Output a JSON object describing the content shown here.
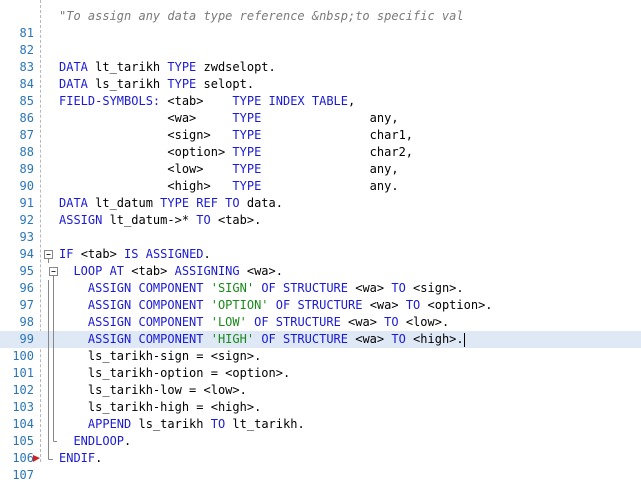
{
  "editor": {
    "highlight_color": "#dfe8f5",
    "keyword_color": "#1b1bd6",
    "string_color": "#1a8a1a",
    "comment_color": "#7a7a7a",
    "line_number_color": "#2b76b9",
    "lines": [
      {
        "n": "",
        "tokens": [
          [
            "cm",
            "\"To assign any data type reference &nbsp;to specific val"
          ]
        ]
      },
      {
        "n": "81",
        "tokens": []
      },
      {
        "n": "82",
        "tokens": []
      },
      {
        "n": "83",
        "tokens": [
          [
            "kw",
            "DATA"
          ],
          [
            "",
            "lt_tarikh "
          ],
          [
            "kw",
            "TYPE"
          ],
          [
            "",
            "zwdselopt."
          ]
        ]
      },
      {
        "n": "84",
        "tokens": [
          [
            "kw",
            "DATA"
          ],
          [
            "",
            "ls_tarikh "
          ],
          [
            "kw",
            "TYPE"
          ],
          [
            "",
            "selopt."
          ]
        ]
      },
      {
        "n": "85",
        "tokens": [
          [
            "kw",
            "FIELD-SYMBOLS:"
          ],
          [
            "",
            "<tab>    "
          ],
          [
            "kw",
            "TYPE INDEX TABLE"
          ],
          [
            "",
            ","
          ]
        ]
      },
      {
        "n": "86",
        "tokens": [
          [
            "",
            "               <wa>     "
          ],
          [
            "kw",
            "TYPE"
          ],
          [
            "",
            "               any,"
          ]
        ]
      },
      {
        "n": "87",
        "tokens": [
          [
            "",
            "               <sign>   "
          ],
          [
            "kw",
            "TYPE"
          ],
          [
            "",
            "               char1,"
          ]
        ]
      },
      {
        "n": "88",
        "tokens": [
          [
            "",
            "               <option> "
          ],
          [
            "kw",
            "TYPE"
          ],
          [
            "",
            "               char2,"
          ]
        ]
      },
      {
        "n": "89",
        "tokens": [
          [
            "",
            "               <low>    "
          ],
          [
            "kw",
            "TYPE"
          ],
          [
            "",
            "               any,"
          ]
        ]
      },
      {
        "n": "90",
        "tokens": [
          [
            "",
            "               <high>   "
          ],
          [
            "kw",
            "TYPE"
          ],
          [
            "",
            "               any."
          ]
        ]
      },
      {
        "n": "91",
        "tokens": [
          [
            "kw",
            "DATA"
          ],
          [
            "",
            "lt_datum "
          ],
          [
            "kw",
            "TYPE REF TO"
          ],
          [
            "",
            "data."
          ]
        ]
      },
      {
        "n": "92",
        "tokens": [
          [
            "kw",
            "ASSIGN"
          ],
          [
            "",
            "lt_datum->* "
          ],
          [
            "kw",
            "TO"
          ],
          [
            "",
            "<tab>."
          ]
        ]
      },
      {
        "n": "93",
        "tokens": []
      },
      {
        "n": "94",
        "fold": "minus",
        "tokens": [
          [
            "kw",
            "IF"
          ],
          [
            "",
            "<tab> "
          ],
          [
            "kw",
            "IS ASSIGNED"
          ],
          [
            "",
            "."
          ]
        ]
      },
      {
        "n": "95",
        "fold": "minus-inner",
        "tokens": [
          [
            "",
            "  "
          ],
          [
            "kw",
            "LOOP AT"
          ],
          [
            "",
            "<tab> "
          ],
          [
            "kw",
            "ASSIGNING"
          ],
          [
            "",
            "<wa>."
          ]
        ]
      },
      {
        "n": "96",
        "fold": "bar",
        "tokens": [
          [
            "",
            "    "
          ],
          [
            "kw",
            "ASSIGN COMPONENT"
          ],
          [
            "str",
            "'SIGN'"
          ],
          [
            "kw",
            "OF STRUCTURE"
          ],
          [
            "",
            "<wa> "
          ],
          [
            "kw",
            "TO"
          ],
          [
            "",
            "<sign>."
          ]
        ]
      },
      {
        "n": "97",
        "fold": "bar",
        "tokens": [
          [
            "",
            "    "
          ],
          [
            "kw",
            "ASSIGN COMPONENT"
          ],
          [
            "str",
            "'OPTION'"
          ],
          [
            "kw",
            "OF STRUCTURE"
          ],
          [
            "",
            "<wa> "
          ],
          [
            "kw",
            "TO"
          ],
          [
            "",
            "<option>."
          ]
        ]
      },
      {
        "n": "98",
        "fold": "bar",
        "tokens": [
          [
            "",
            "    "
          ],
          [
            "kw",
            "ASSIGN COMPONENT"
          ],
          [
            "str",
            "'LOW'"
          ],
          [
            "kw",
            "OF STRUCTURE"
          ],
          [
            "",
            "<wa> "
          ],
          [
            "kw",
            "TO"
          ],
          [
            "",
            "<low>."
          ]
        ]
      },
      {
        "n": "99",
        "fold": "bar",
        "highlight": true,
        "tokens": [
          [
            "",
            "    "
          ],
          [
            "kw",
            "ASSIGN COMPONENT"
          ],
          [
            "str",
            "'HIGH'"
          ],
          [
            "kw",
            "OF STRUCTURE"
          ],
          [
            "",
            "<wa> "
          ],
          [
            "kw",
            "TO"
          ],
          [
            "",
            "<high>."
          ]
        ]
      },
      {
        "n": "100",
        "fold": "bar",
        "tokens": [
          [
            "",
            "    ls_tarikh-sign = <sign>."
          ]
        ]
      },
      {
        "n": "101",
        "fold": "bar",
        "tokens": [
          [
            "",
            "    ls_tarikh-option = <option>."
          ]
        ]
      },
      {
        "n": "102",
        "fold": "bar",
        "tokens": [
          [
            "",
            "    ls_tarikh-low = <low>."
          ]
        ]
      },
      {
        "n": "103",
        "fold": "bar",
        "tokens": [
          [
            "",
            "    ls_tarikh-high = <high>."
          ]
        ]
      },
      {
        "n": "104",
        "fold": "bar",
        "tokens": [
          [
            "",
            "    "
          ],
          [
            "kw",
            "APPEND"
          ],
          [
            "",
            "ls_tarikh "
          ],
          [
            "kw",
            "TO"
          ],
          [
            "",
            "lt_tarikh."
          ]
        ]
      },
      {
        "n": "105",
        "fold": "end-inner",
        "tokens": [
          [
            "",
            "  "
          ],
          [
            "kw",
            "ENDLOOP"
          ],
          [
            "",
            "."
          ]
        ]
      },
      {
        "n": "106",
        "fold": "end",
        "tokens": [
          [
            "kw",
            "ENDIF"
          ],
          [
            "",
            "."
          ]
        ]
      },
      {
        "n": "107",
        "tokens": []
      }
    ]
  }
}
